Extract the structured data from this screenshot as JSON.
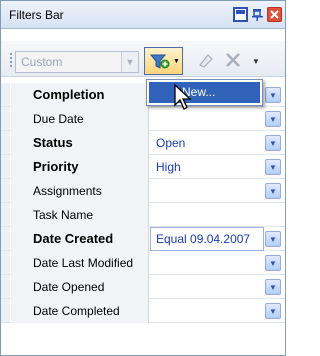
{
  "window": {
    "title": "Filters Bar"
  },
  "toolbar": {
    "view_selector": {
      "value": "Custom"
    }
  },
  "popup_menu": {
    "items": [
      {
        "label": "New..."
      }
    ]
  },
  "filter_grid": {
    "rows": [
      {
        "label": "Completion",
        "bold": true,
        "value": ""
      },
      {
        "label": "Due Date",
        "bold": false,
        "value": ""
      },
      {
        "label": "Status",
        "bold": true,
        "value": "Open"
      },
      {
        "label": "Priority",
        "bold": true,
        "value": "High"
      },
      {
        "label": "Assignments",
        "bold": false,
        "value": ""
      },
      {
        "label": "Task Name",
        "bold": false,
        "value": ""
      },
      {
        "label": "Date Created",
        "bold": true,
        "value": "Equal 09.04.2007"
      },
      {
        "label": "Date Last Modified",
        "bold": false,
        "value": ""
      },
      {
        "label": "Date Opened",
        "bold": false,
        "value": ""
      },
      {
        "label": "Date Completed",
        "bold": false,
        "value": ""
      }
    ]
  },
  "icons": {
    "float_panel": "dock-float-icon",
    "pin": "pin-icon",
    "close": "close-icon",
    "new_filter": "filter-add-icon",
    "eraser": "eraser-icon",
    "clear": "clear-icon",
    "toolbar_options": "toolbar-options-icon",
    "cursor": "mouse-pointer-icon"
  },
  "colors": {
    "title_bar_start": "#eef3fb",
    "title_bar_end": "#d6e2f3",
    "menu_highlight": "#2f62b8",
    "value_text": "#1a3db0",
    "close_button": "#e0503c"
  }
}
